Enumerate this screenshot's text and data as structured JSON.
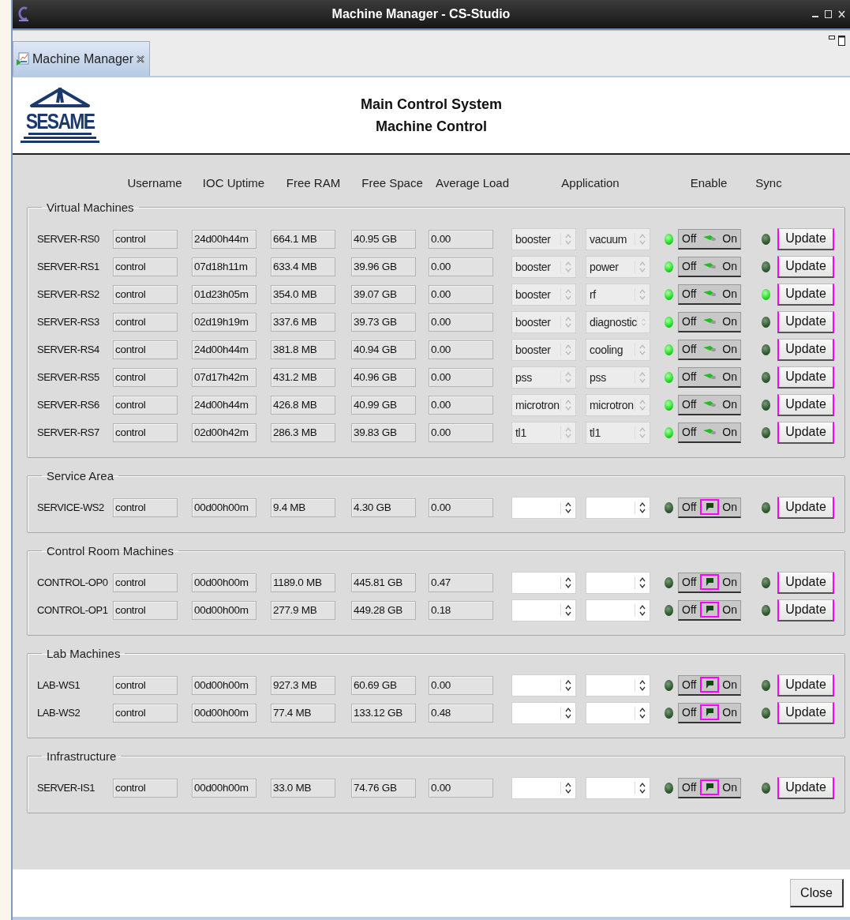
{
  "window": {
    "title": "Machine Manager - CS-Studio"
  },
  "tab": {
    "label": "Machine Manager",
    "selected": true
  },
  "header": {
    "logo": "SESAME",
    "title": "Main Control System",
    "subtitle": "Machine Control"
  },
  "columns": [
    "Username",
    "IOC Uptime",
    "Free RAM",
    "Free Space",
    "Average Load",
    "Application",
    "Enable",
    "Sync"
  ],
  "groups": [
    {
      "title": "Virtual Machines",
      "rows": [
        {
          "name": "SERVER-RS0",
          "username": "control",
          "uptime": "24d00h44m",
          "ram": "664.1 MB",
          "space": "40.95 GB",
          "load": "0.00",
          "app": "booster",
          "subsystem": "vacuum",
          "enabled": true,
          "switch": {
            "off": "Off",
            "on": "On"
          },
          "synced": false,
          "button": "Update"
        },
        {
          "name": "SERVER-RS1",
          "username": "control",
          "uptime": "07d18h11m",
          "ram": "633.4 MB",
          "space": "39.96 GB",
          "load": "0.00",
          "app": "booster",
          "subsystem": "power",
          "enabled": true,
          "switch": {
            "off": "Off",
            "on": "On"
          },
          "synced": false,
          "button": "Update"
        },
        {
          "name": "SERVER-RS2",
          "username": "control",
          "uptime": "01d23h05m",
          "ram": "354.0 MB",
          "space": "39.07 GB",
          "load": "0.00",
          "app": "booster",
          "subsystem": "rf",
          "enabled": true,
          "switch": {
            "off": "Off",
            "on": "On"
          },
          "synced": true,
          "button": "Update"
        },
        {
          "name": "SERVER-RS3",
          "username": "control",
          "uptime": "02d19h19m",
          "ram": "337.6 MB",
          "space": "39.73 GB",
          "load": "0.00",
          "app": "booster",
          "subsystem": "diagnostic",
          "enabled": true,
          "switch": {
            "off": "Off",
            "on": "On"
          },
          "synced": false,
          "button": "Update"
        },
        {
          "name": "SERVER-RS4",
          "username": "control",
          "uptime": "24d00h44m",
          "ram": "381.8 MB",
          "space": "40.94 GB",
          "load": "0.00",
          "app": "booster",
          "subsystem": "cooling",
          "enabled": true,
          "switch": {
            "off": "Off",
            "on": "On"
          },
          "synced": false,
          "button": "Update"
        },
        {
          "name": "SERVER-RS5",
          "username": "control",
          "uptime": "07d17h42m",
          "ram": "431.2 MB",
          "space": "40.96 GB",
          "load": "0.00",
          "app": "pss",
          "subsystem": "pss",
          "enabled": true,
          "switch": {
            "off": "Off",
            "on": "On"
          },
          "synced": false,
          "button": "Update"
        },
        {
          "name": "SERVER-RS6",
          "username": "control",
          "uptime": "24d00h44m",
          "ram": "426.8 MB",
          "space": "40.99 GB",
          "load": "0.00",
          "app": "microtron",
          "subsystem": "microtron",
          "enabled": true,
          "switch": {
            "off": "Off",
            "on": "On"
          },
          "synced": false,
          "button": "Update"
        },
        {
          "name": "SERVER-RS7",
          "username": "control",
          "uptime": "02d00h42m",
          "ram": "286.3 MB",
          "space": "39.83 GB",
          "load": "0.00",
          "app": "tl1",
          "subsystem": "tl1",
          "enabled": true,
          "switch": {
            "off": "Off",
            "on": "On"
          },
          "synced": false,
          "button": "Update"
        }
      ]
    },
    {
      "title": "Service Area",
      "rows": [
        {
          "name": "SERVICE-WS2",
          "username": "control",
          "uptime": "00d00h00m",
          "ram": "9.4 MB",
          "space": "4.30 GB",
          "load": "0.00",
          "enabled": false,
          "switch": {
            "off": "Off",
            "on": "On"
          },
          "synced": false,
          "button": "Update"
        }
      ]
    },
    {
      "title": "Control Room Machines",
      "rows": [
        {
          "name": "CONTROL-OP0",
          "username": "control",
          "uptime": "00d00h00m",
          "ram": "1189.0 MB",
          "space": "445.81 GB",
          "load": "0.47",
          "enabled": false,
          "switch": {
            "off": "Off",
            "on": "On"
          },
          "synced": false,
          "button": "Update"
        },
        {
          "name": "CONTROL-OP1",
          "username": "control",
          "uptime": "00d00h00m",
          "ram": "277.9 MB",
          "space": "449.28 GB",
          "load": "0.18",
          "enabled": false,
          "switch": {
            "off": "Off",
            "on": "On"
          },
          "synced": false,
          "button": "Update"
        }
      ]
    },
    {
      "title": "Lab Machines",
      "rows": [
        {
          "name": "LAB-WS1",
          "username": "control",
          "uptime": "00d00h00m",
          "ram": "927.3 MB",
          "space": "60.69 GB",
          "load": "0.00",
          "enabled": false,
          "switch": {
            "off": "Off",
            "on": "On"
          },
          "synced": false,
          "button": "Update"
        },
        {
          "name": "LAB-WS2",
          "username": "control",
          "uptime": "00d00h00m",
          "ram": "77.4 MB",
          "space": "133.12 GB",
          "load": "0.48",
          "enabled": false,
          "switch": {
            "off": "Off",
            "on": "On"
          },
          "synced": false,
          "button": "Update"
        }
      ]
    },
    {
      "title": "Infrastructure",
      "rows": [
        {
          "name": "SERVER-IS1",
          "username": "control",
          "uptime": "00d00h00m",
          "ram": "33.0 MB",
          "space": "74.76 GB",
          "load": "0.00",
          "enabled": false,
          "switch": {
            "off": "Off",
            "on": "On"
          },
          "synced": false,
          "button": "Update"
        }
      ]
    }
  ],
  "close_button": "Close"
}
